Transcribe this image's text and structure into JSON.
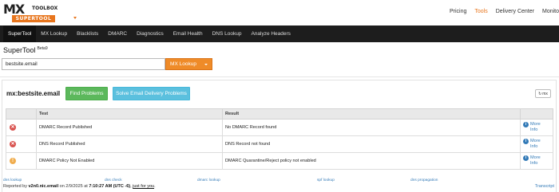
{
  "brand": {
    "logo_main": "MX",
    "logo_toolbox": "TOOLBOX",
    "logo_sub": "SUPERTOOL",
    "accent_color": "#ef8b28"
  },
  "top_nav": [
    "Pricing",
    "Tools",
    "Delivery Center",
    "Monito"
  ],
  "tabs": [
    "SuperTool",
    "MX Lookup",
    "Blacklists",
    "DMARC",
    "Diagnostics",
    "Email Health",
    "DNS Lookup",
    "Analyze Headers"
  ],
  "page": {
    "title": "SuperTool",
    "beta": "Beta9"
  },
  "search": {
    "value": "bestsite.email",
    "button_label": "MX Lookup"
  },
  "result": {
    "title": "mx:bestsite.email",
    "find_problems": "Find Problems",
    "solve": "Solve Email Delivery Problems",
    "refresh_label": "mx"
  },
  "table": {
    "headers": [
      "",
      "Test",
      "Result",
      ""
    ],
    "rows": [
      {
        "status": "error",
        "test": "DMARC Record Published",
        "result": "No DMARC Record found",
        "more": "More",
        "info": "Info"
      },
      {
        "status": "error",
        "test": "DNS Record Published",
        "result": "DNS Record not found",
        "more": "More",
        "info": "Info"
      },
      {
        "status": "warning",
        "test": "DMARC Policy Not Enabled",
        "result": "DMARC Quarantine/Reject policy not enabled",
        "more": "More",
        "info": "Info"
      }
    ]
  },
  "footer_links": [
    "dns lookup",
    "dns check",
    "dmarc lookup",
    "spf lookup",
    "dns propagation"
  ],
  "report": {
    "prefix": "Reported by ",
    "server": "v2n0.nic.email",
    "on": " on 2/9/2025 at ",
    "time": "7:10:27 AM (UTC -6)",
    "comma": ", ",
    "just": "just for you",
    "period": ".",
    "transcript": "Transcript"
  }
}
